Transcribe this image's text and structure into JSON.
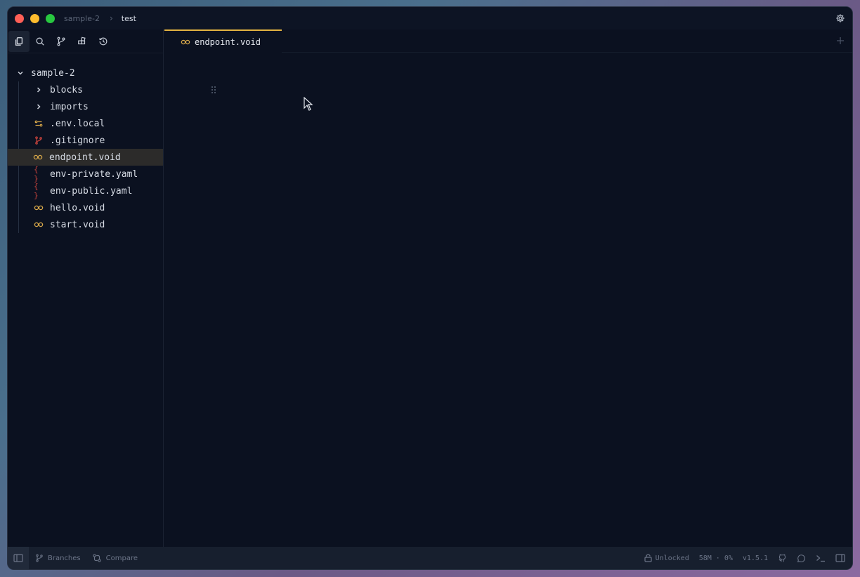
{
  "titlebar": {
    "breadcrumb": [
      "sample-2",
      "test"
    ]
  },
  "sidebar": {
    "tabs": [
      "files-icon",
      "search-icon",
      "git-branch-icon",
      "blocks-icon",
      "history-icon"
    ],
    "tree": {
      "root": "sample-2",
      "items": [
        {
          "label": "blocks",
          "icon": "chevron-right-icon",
          "type": "folder"
        },
        {
          "label": "imports",
          "icon": "chevron-right-icon",
          "type": "folder"
        },
        {
          "label": ".env.local",
          "icon": "env-icon",
          "type": "file"
        },
        {
          "label": ".gitignore",
          "icon": "git-icon",
          "type": "file"
        },
        {
          "label": "endpoint.void",
          "icon": "void-icon",
          "type": "file",
          "selected": true
        },
        {
          "label": "env-private.yaml",
          "icon": "yaml-icon",
          "type": "file"
        },
        {
          "label": "env-public.yaml",
          "icon": "yaml-icon",
          "type": "file"
        },
        {
          "label": "hello.void",
          "icon": "void-icon",
          "type": "file"
        },
        {
          "label": "start.void",
          "icon": "void-icon",
          "type": "file"
        }
      ]
    }
  },
  "editor": {
    "tabs": [
      {
        "label": "endpoint.void",
        "active": true
      }
    ]
  },
  "statusbar": {
    "branches": "Branches",
    "compare": "Compare",
    "lock": "Unlocked",
    "memory": "58M",
    "cpu": "0%",
    "version": "v1.5.1"
  },
  "colors": {
    "accent": "#e3b341",
    "void_icon": "#d9a94a",
    "yaml_icon": "#c0413b",
    "git_icon": "#c0413b",
    "env_icon": "#d9a94a",
    "background": "#0b1120"
  }
}
